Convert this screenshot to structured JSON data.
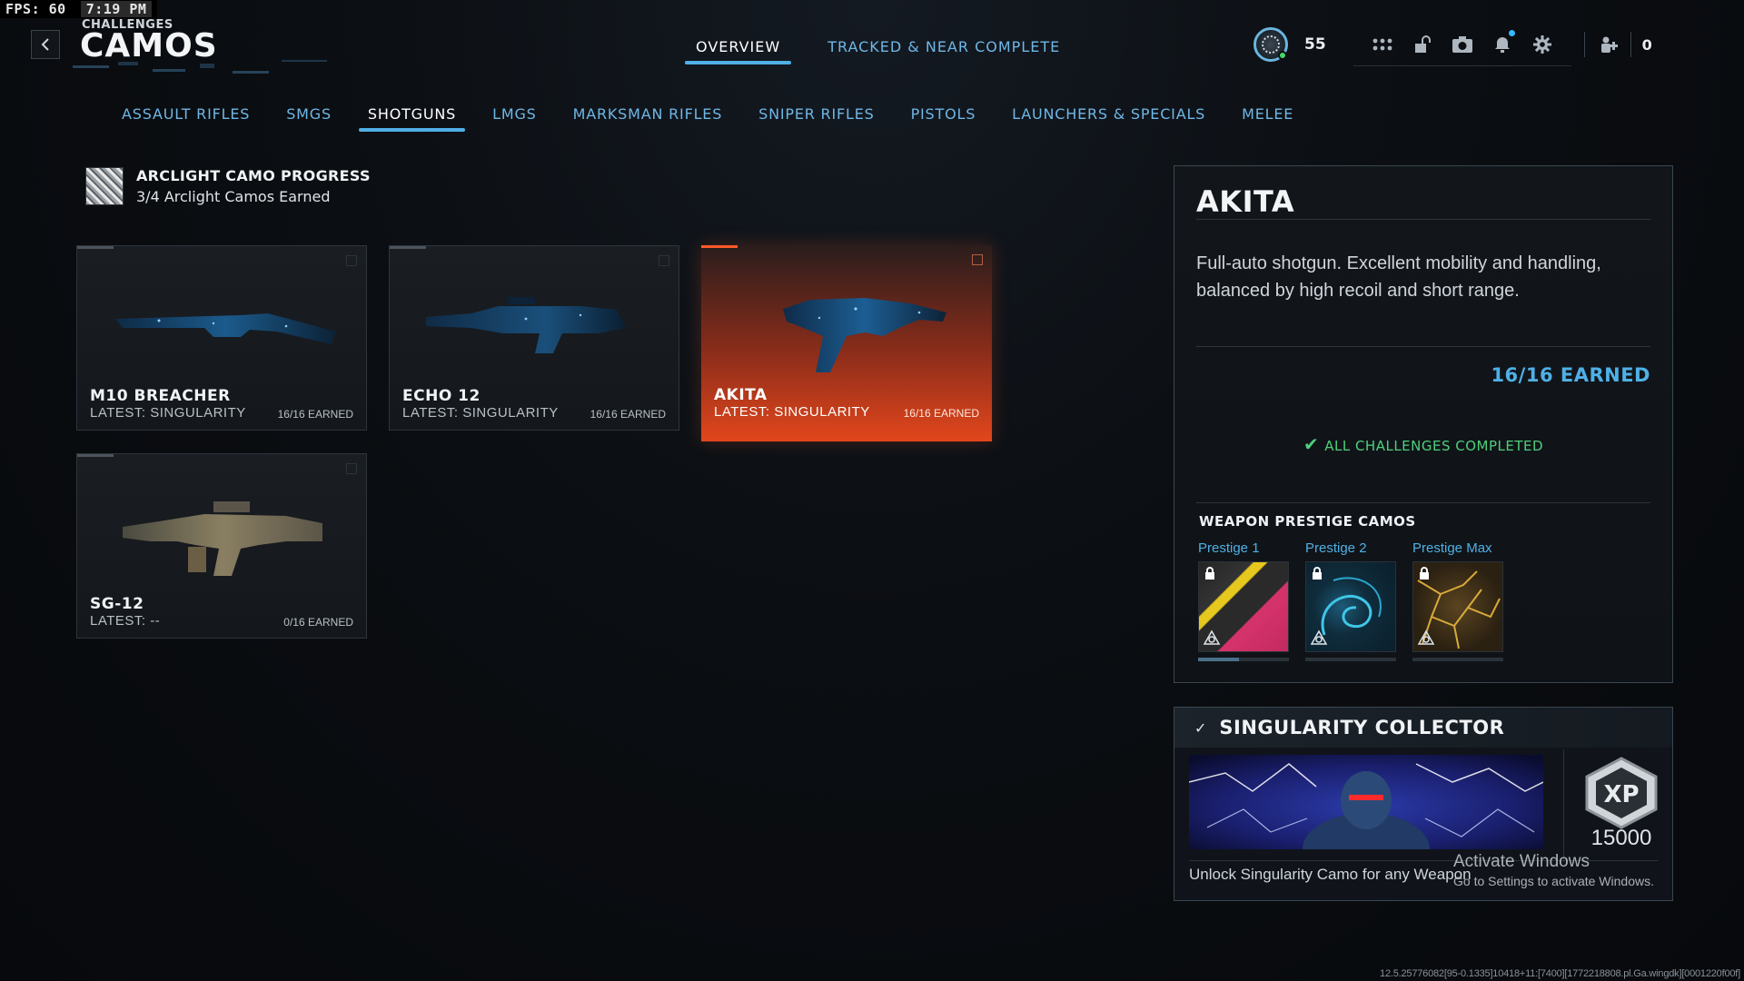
{
  "overlay": {
    "fps_label": "FPS:",
    "fps_value": "60",
    "clock": "7:19 PM"
  },
  "header": {
    "back_icon": "chevron-left-icon",
    "breadcrumb": "CHALLENGES",
    "title": "CAMOS",
    "tabs": [
      {
        "label": "OVERVIEW",
        "active": true
      },
      {
        "label": "TRACKED & NEAR COMPLETE",
        "active": false
      }
    ],
    "player_level": "55",
    "hud_icons": [
      "grid-icon",
      "unlock-icon",
      "camera-icon",
      "bell-icon",
      "gear-icon"
    ],
    "party_icon": "party-icon",
    "party_count": "0"
  },
  "categories": [
    {
      "label": "ASSAULT RIFLES",
      "active": false
    },
    {
      "label": "SMGS",
      "active": false
    },
    {
      "label": "SHOTGUNS",
      "active": true
    },
    {
      "label": "LMGS",
      "active": false
    },
    {
      "label": "MARKSMAN RIFLES",
      "active": false
    },
    {
      "label": "SNIPER RIFLES",
      "active": false
    },
    {
      "label": "PISTOLS",
      "active": false
    },
    {
      "label": "LAUNCHERS & SPECIALS",
      "active": false
    },
    {
      "label": "MELEE",
      "active": false
    }
  ],
  "arclight": {
    "title": "ARCLIGHT CAMO PROGRESS",
    "subtitle": "3/4 Arclight Camos Earned"
  },
  "weapons": [
    {
      "name": "M10 BREACHER",
      "latest": "LATEST: SINGULARITY",
      "earned": "16/16 EARNED",
      "selected": false
    },
    {
      "name": "ECHO 12",
      "latest": "LATEST: SINGULARITY",
      "earned": "16/16 EARNED",
      "selected": false
    },
    {
      "name": "AKITA",
      "latest": "LATEST: SINGULARITY",
      "earned": "16/16 EARNED",
      "selected": true
    },
    {
      "name": "SG-12",
      "latest": "LATEST: --",
      "earned": "0/16 EARNED",
      "selected": false
    }
  ],
  "detail": {
    "title": "AKITA",
    "description": "Full-auto shotgun. Excellent mobility and handling, balanced by high recoil and short range.",
    "earned": "16/16 EARNED",
    "status": "ALL CHALLENGES COMPLETED",
    "prestige_heading": "WEAPON PRESTIGE CAMOS",
    "prestige": [
      {
        "label": "Prestige 1",
        "locked": true
      },
      {
        "label": "Prestige 2",
        "locked": true
      },
      {
        "label": "Prestige Max",
        "locked": true
      }
    ]
  },
  "reward": {
    "title": "SINGULARITY COLLECTOR",
    "description": "Unlock Singularity Camo for any Weapon",
    "xp_label": "XP",
    "xp": "15000"
  },
  "watermark": {
    "line1": "Activate Windows",
    "line2": "Go to Settings to activate Windows."
  },
  "build_string": "12.5.25776082[95-0.1335]10418+11:[7400][1772218808.pl.Ga.wingdk][0001220f00f]",
  "colors": {
    "accent": "#4fb0e6",
    "selected": "#e2461c",
    "success": "#4ed07a"
  }
}
